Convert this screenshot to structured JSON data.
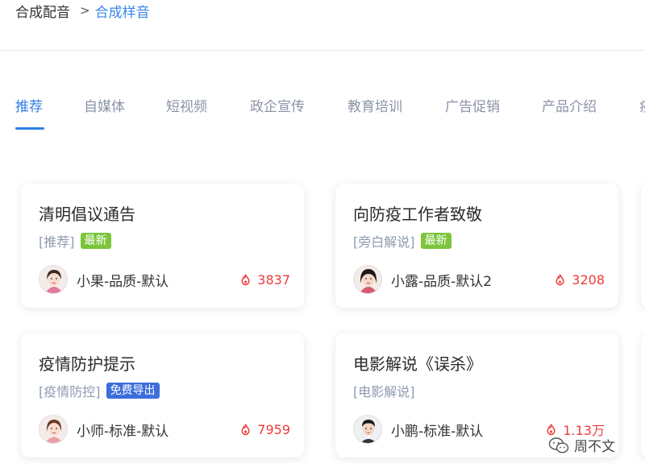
{
  "breadcrumb": {
    "root": "合成配音",
    "separator": ">",
    "current": "合成样音"
  },
  "tabs": [
    {
      "label": "推荐",
      "active": true
    },
    {
      "label": "自媒体"
    },
    {
      "label": "短视频"
    },
    {
      "label": "政企宣传"
    },
    {
      "label": "教育培训"
    },
    {
      "label": "广告促销"
    },
    {
      "label": "产品介绍"
    },
    {
      "label": "疫"
    }
  ],
  "cards": [
    {
      "title": "清明倡议通告",
      "category": "[推荐]",
      "badge": "最新",
      "badge_color": "#7bc43c",
      "voice": "小果-品质-默认",
      "plays": "3837",
      "avatar_type": "female"
    },
    {
      "title": "向防疫工作者致敬",
      "category": "[旁白解说]",
      "badge": "最新",
      "badge_color": "#7bc43c",
      "voice": "小露-品质-默认2",
      "plays": "3208",
      "avatar_type": "female-dark"
    },
    {
      "title": "疫情防护提示",
      "category": "[疫情防控]",
      "badge": "免费导出",
      "badge_color": "#3d6fdc",
      "voice": "小师-标准-默认",
      "plays": "7959",
      "avatar_type": "female"
    },
    {
      "title": "电影解说《误杀》",
      "category": "[电影解说]",
      "badge": "",
      "voice": "小鹏-标准-默认",
      "plays": "1.13万",
      "avatar_type": "male"
    }
  ],
  "watermark": {
    "text": "周不文"
  },
  "colors": {
    "accent": "#2f7fe6",
    "plays": "#ee3b3b",
    "badge_new": "#7bc43c",
    "badge_free": "#3d6fdc"
  },
  "icons": {
    "plays": "fire-icon",
    "watermark": "wechat-icon"
  }
}
